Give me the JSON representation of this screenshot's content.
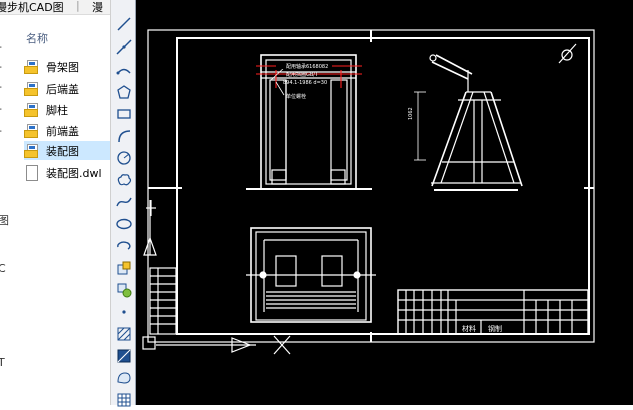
{
  "window": {
    "tab_title": "漫步机CAD图",
    "tab_title_next": "漫",
    "separator": "|"
  },
  "explorer": {
    "column_header": "名称",
    "edge_chars": [
      "-",
      "-",
      "-",
      "-",
      "-",
      "图",
      "C",
      "T"
    ],
    "files": [
      {
        "name": "骨架图",
        "icon": "cad-file-icon",
        "selected": false
      },
      {
        "name": "后端盖",
        "icon": "cad-file-icon",
        "selected": false
      },
      {
        "name": "脚柱",
        "icon": "cad-file-icon",
        "selected": false
      },
      {
        "name": "前端盖",
        "icon": "cad-file-icon",
        "selected": false
      },
      {
        "name": "装配图",
        "icon": "cad-file-icon",
        "selected": true
      },
      {
        "name": "装配图.dwl",
        "icon": "document-icon",
        "selected": false
      }
    ]
  },
  "toolbar": {
    "tools": [
      "line-icon",
      "construction-line-icon",
      "polyline-icon",
      "polygon-icon",
      "rectangle-icon",
      "arc-icon",
      "circle-icon",
      "revision-cloud-icon",
      "spline-icon",
      "ellipse-icon",
      "ellipse-arc-icon",
      "insert-block-icon",
      "make-block-icon",
      "point-icon",
      "hatch-icon",
      "gradient-icon",
      "region-icon",
      "table-icon"
    ]
  },
  "drawing": {
    "callouts": [
      "配用轴承6168082",
      "配用挡圈GB/T",
      "894.1-1986 d=30",
      "单位螺栓"
    ],
    "dimension": "1062",
    "title_block": {
      "material_label": "材料",
      "material_value": "钢制"
    },
    "colors": {
      "background": "#000000",
      "lines": "#ffffff",
      "red_lines": "#ff2020"
    }
  }
}
